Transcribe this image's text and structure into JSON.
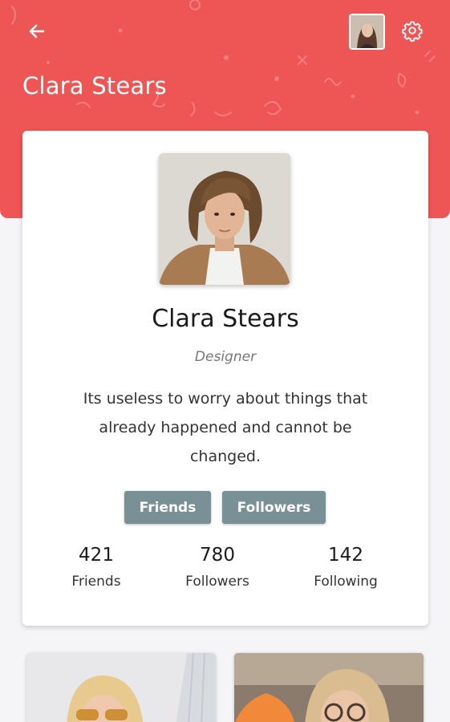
{
  "header": {
    "title": "Clara Stears",
    "back_icon": "arrow-left-icon",
    "settings_icon": "gear-icon",
    "background_color": "#ee5555"
  },
  "profile": {
    "name": "Clara Stears",
    "role": "Designer",
    "bio": "Its useless to worry about things that already happened and cannot be changed.",
    "buttons": [
      {
        "label": "Friends"
      },
      {
        "label": "Followers"
      }
    ],
    "stats": [
      {
        "value": "421",
        "label": "Friends"
      },
      {
        "value": "780",
        "label": "Followers"
      },
      {
        "value": "142",
        "label": "Following"
      }
    ],
    "button_color": "#7a9097"
  }
}
